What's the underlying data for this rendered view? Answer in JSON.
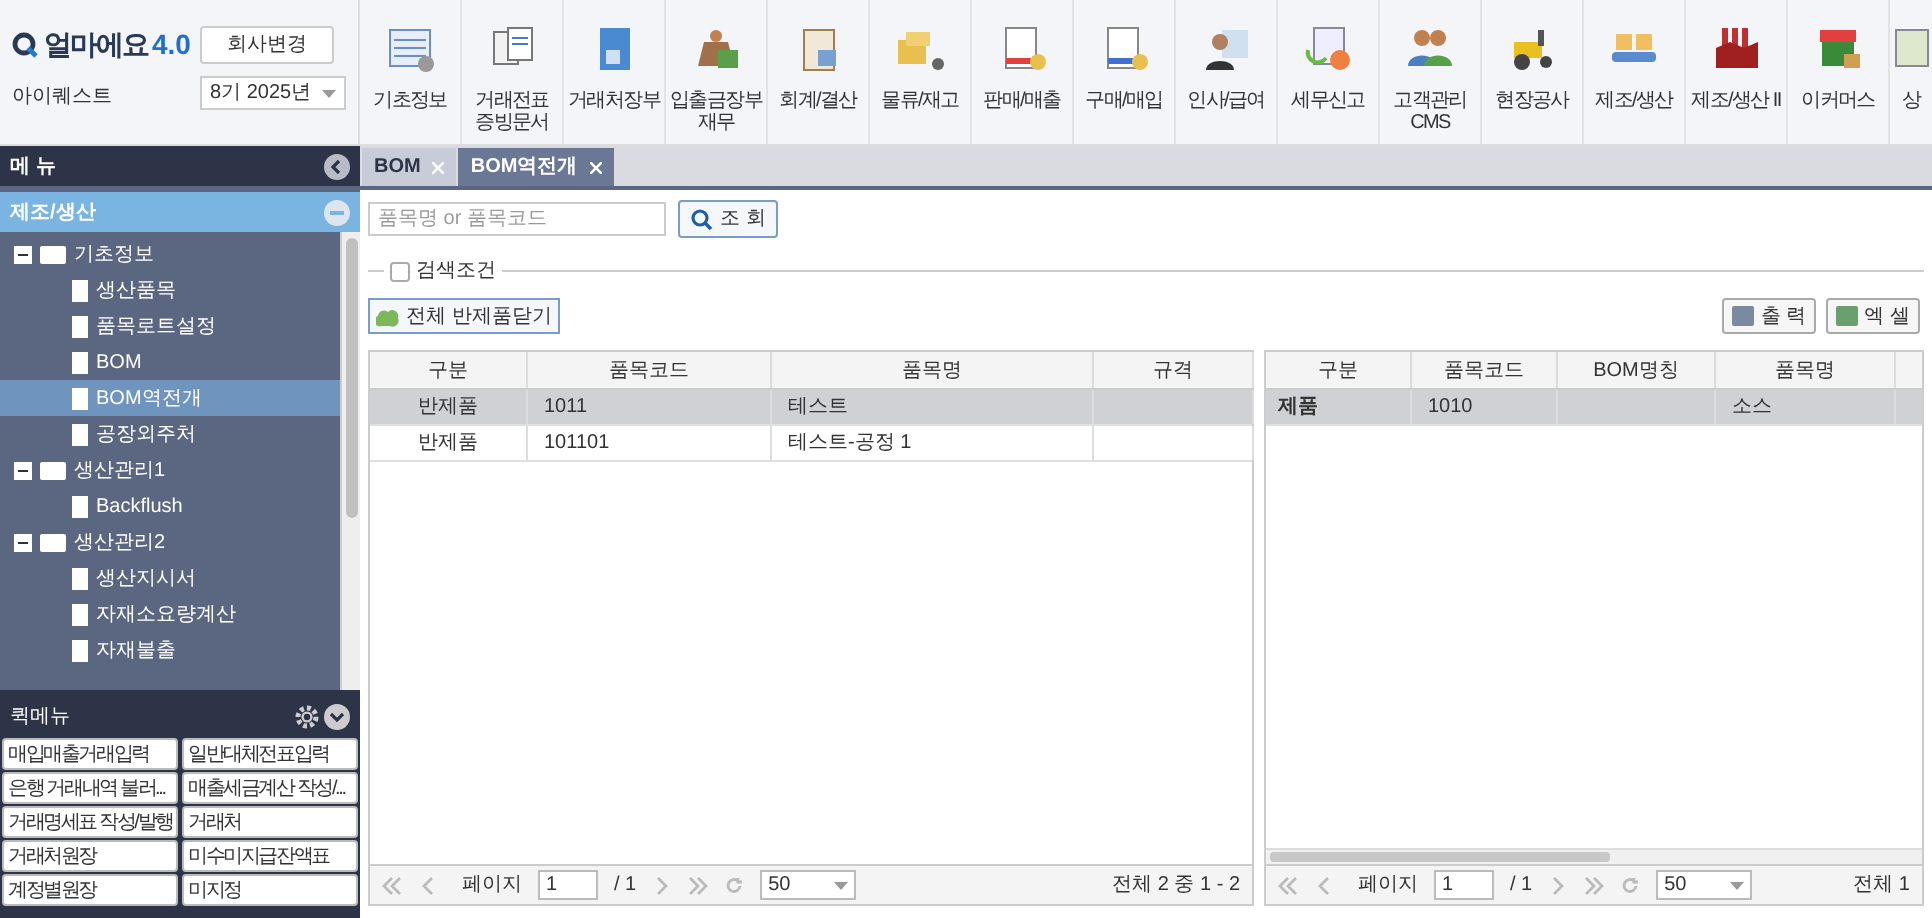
{
  "header": {
    "logo": "얼마에요",
    "version": "4.0",
    "company": "아이퀘스트",
    "change_company_button": "회사변경",
    "period": "8기 2025년"
  },
  "toolbar": [
    {
      "label": "기초정보"
    },
    {
      "label": "거래전표\n증빙문서"
    },
    {
      "label": "거래처장부"
    },
    {
      "label": "입출금장부\n재무"
    },
    {
      "label": "회계/결산"
    },
    {
      "label": "물류/재고"
    },
    {
      "label": "판매/매출"
    },
    {
      "label": "구매/매입"
    },
    {
      "label": "인사/급여"
    },
    {
      "label": "세무신고"
    },
    {
      "label": "고객관리\nCMS"
    },
    {
      "label": "현장공사"
    },
    {
      "label": "제조/생산"
    },
    {
      "label": "제조/생산 II"
    },
    {
      "label": "이커머스"
    },
    {
      "label": "상"
    }
  ],
  "menu_panel": {
    "title": "메 뉴",
    "section": {
      "title": "제조/생산",
      "expanded": true
    },
    "tree": [
      {
        "label": "기초정보",
        "expanded": true,
        "children": [
          {
            "label": "생산품목",
            "selected": false
          },
          {
            "label": "품목로트설정",
            "selected": false
          },
          {
            "label": "BOM",
            "selected": false
          },
          {
            "label": "BOM역전개",
            "selected": true
          },
          {
            "label": "공장외주처",
            "selected": false
          }
        ]
      },
      {
        "label": "생산관리1",
        "expanded": true,
        "children": [
          {
            "label": "Backflush",
            "selected": false
          }
        ]
      },
      {
        "label": "생산관리2",
        "expanded": true,
        "children": [
          {
            "label": "생산지시서",
            "selected": false
          },
          {
            "label": "자재소요량계산",
            "selected": false
          },
          {
            "label": "자재불출",
            "selected": false
          }
        ]
      }
    ]
  },
  "quick_menu": {
    "title": "퀵메뉴",
    "items": [
      "매입매출거래입력",
      "일반대체전표입력",
      "은행 거래내역 불러...",
      "매출세금계산 작성/...",
      "거래명세표 작성/발행",
      "거래처",
      "거래처원장",
      "미수미지급잔액표",
      "계정별원장",
      "미지정"
    ]
  },
  "tabs": [
    {
      "label": "BOM",
      "selected": false
    },
    {
      "label": "BOM역전개",
      "selected": true
    }
  ],
  "search": {
    "placeholder": "품목명 or 품목코드",
    "button": "조 회"
  },
  "filter": {
    "label": "검색조건",
    "checked": false
  },
  "collapse_button": "전체 반제품닫기",
  "actions": [
    "출 력",
    "엑 셀"
  ],
  "left_grid": {
    "columns": [
      "구분",
      "품목코드",
      "품목명",
      "규격"
    ],
    "rows": [
      {
        "cells": [
          "반제품",
          "1011",
          "테스트",
          ""
        ],
        "selected": true
      },
      {
        "cells": [
          "반제품",
          "101101",
          "테스트-공정 1",
          ""
        ],
        "selected": false
      }
    ],
    "pager": {
      "label": "페이지",
      "page": "1",
      "total_pages": "/ 1",
      "page_size": "50",
      "summary": "전체 2 중 1 - 2"
    }
  },
  "right_grid": {
    "columns": [
      "구분",
      "품목코드",
      "BOM명칭",
      "품목명"
    ],
    "rows": [
      {
        "cells": [
          "제품",
          "1010",
          "",
          "소스"
        ],
        "selected": true
      }
    ],
    "pager": {
      "label": "페이지",
      "page": "1",
      "total_pages": "/ 1",
      "page_size": "50",
      "summary": "전체 1"
    }
  }
}
